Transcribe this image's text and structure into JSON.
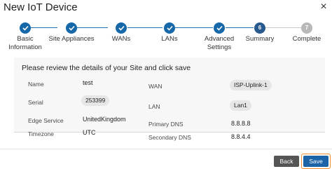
{
  "dialog": {
    "title": "New IoT Device",
    "close_glyph": "×"
  },
  "stepper": {
    "steps": [
      {
        "label": "Basic\nInformation",
        "state": "done"
      },
      {
        "label": "Site Appliances",
        "state": "done"
      },
      {
        "label": "WANs",
        "state": "done"
      },
      {
        "label": "LANs",
        "state": "done"
      },
      {
        "label": "Advanced\nSettings",
        "state": "done"
      },
      {
        "label": "Summary",
        "state": "current",
        "number": "6"
      },
      {
        "label": "Complete",
        "state": "pending",
        "number": "7"
      }
    ]
  },
  "summary": {
    "prompt": "Please review the details of your Site and click save",
    "left": {
      "name_label": "Name",
      "name_value": "test",
      "serial_label": "Serial",
      "serial_value": "253399",
      "edge_service_label": "Edge Service",
      "edge_service_value": "UnitedKingdom",
      "timezone_label": "Timezone",
      "timezone_value": "UTC"
    },
    "right": {
      "wan_label": "WAN",
      "wan_value": "ISP-Uplink-1",
      "lan_label": "LAN",
      "lan_value": "Lan1",
      "primary_dns_label": "Primary DNS",
      "primary_dns_value": "8.8.8.8",
      "secondary_dns_label": "Secondary DNS",
      "secondary_dns_value": "8.8.4.4"
    }
  },
  "footer": {
    "back_label": "Back",
    "save_label": "Save"
  },
  "colors": {
    "step_done": "#1668a8",
    "step_pending": "#b8b8b8",
    "save_button": "#1c63a8",
    "save_focus_outline": "#f28a2e",
    "back_button": "#555555"
  },
  "icons": {
    "step_done_icon": "checkmark-icon",
    "close_icon": "close-icon"
  }
}
